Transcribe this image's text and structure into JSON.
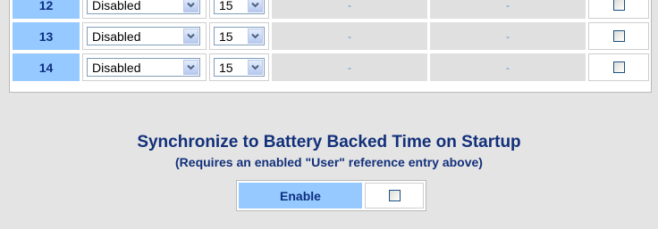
{
  "schedule_table": {
    "rows": [
      {
        "number": "12",
        "mode": "Disabled",
        "interval": "15",
        "value_a": "-",
        "value_b": "-",
        "checked": false
      },
      {
        "number": "13",
        "mode": "Disabled",
        "interval": "15",
        "value_a": "-",
        "value_b": "-",
        "checked": false
      },
      {
        "number": "14",
        "mode": "Disabled",
        "interval": "15",
        "value_a": "-",
        "value_b": "-",
        "checked": false
      }
    ]
  },
  "sync_section": {
    "title": "Synchronize to Battery Backed Time on Startup",
    "subtitle": "(Requires an enabled \"User\" reference entry above)",
    "enable_label": "Enable",
    "enabled": false
  },
  "colors": {
    "page_bg": "#e4e4e4",
    "label_cell_bg": "#96c9ff",
    "label_text": "#0d2f80",
    "disabled_cell_bg": "#e0e0e0"
  },
  "icons": {
    "dropdown": "chevron-down-icon"
  }
}
